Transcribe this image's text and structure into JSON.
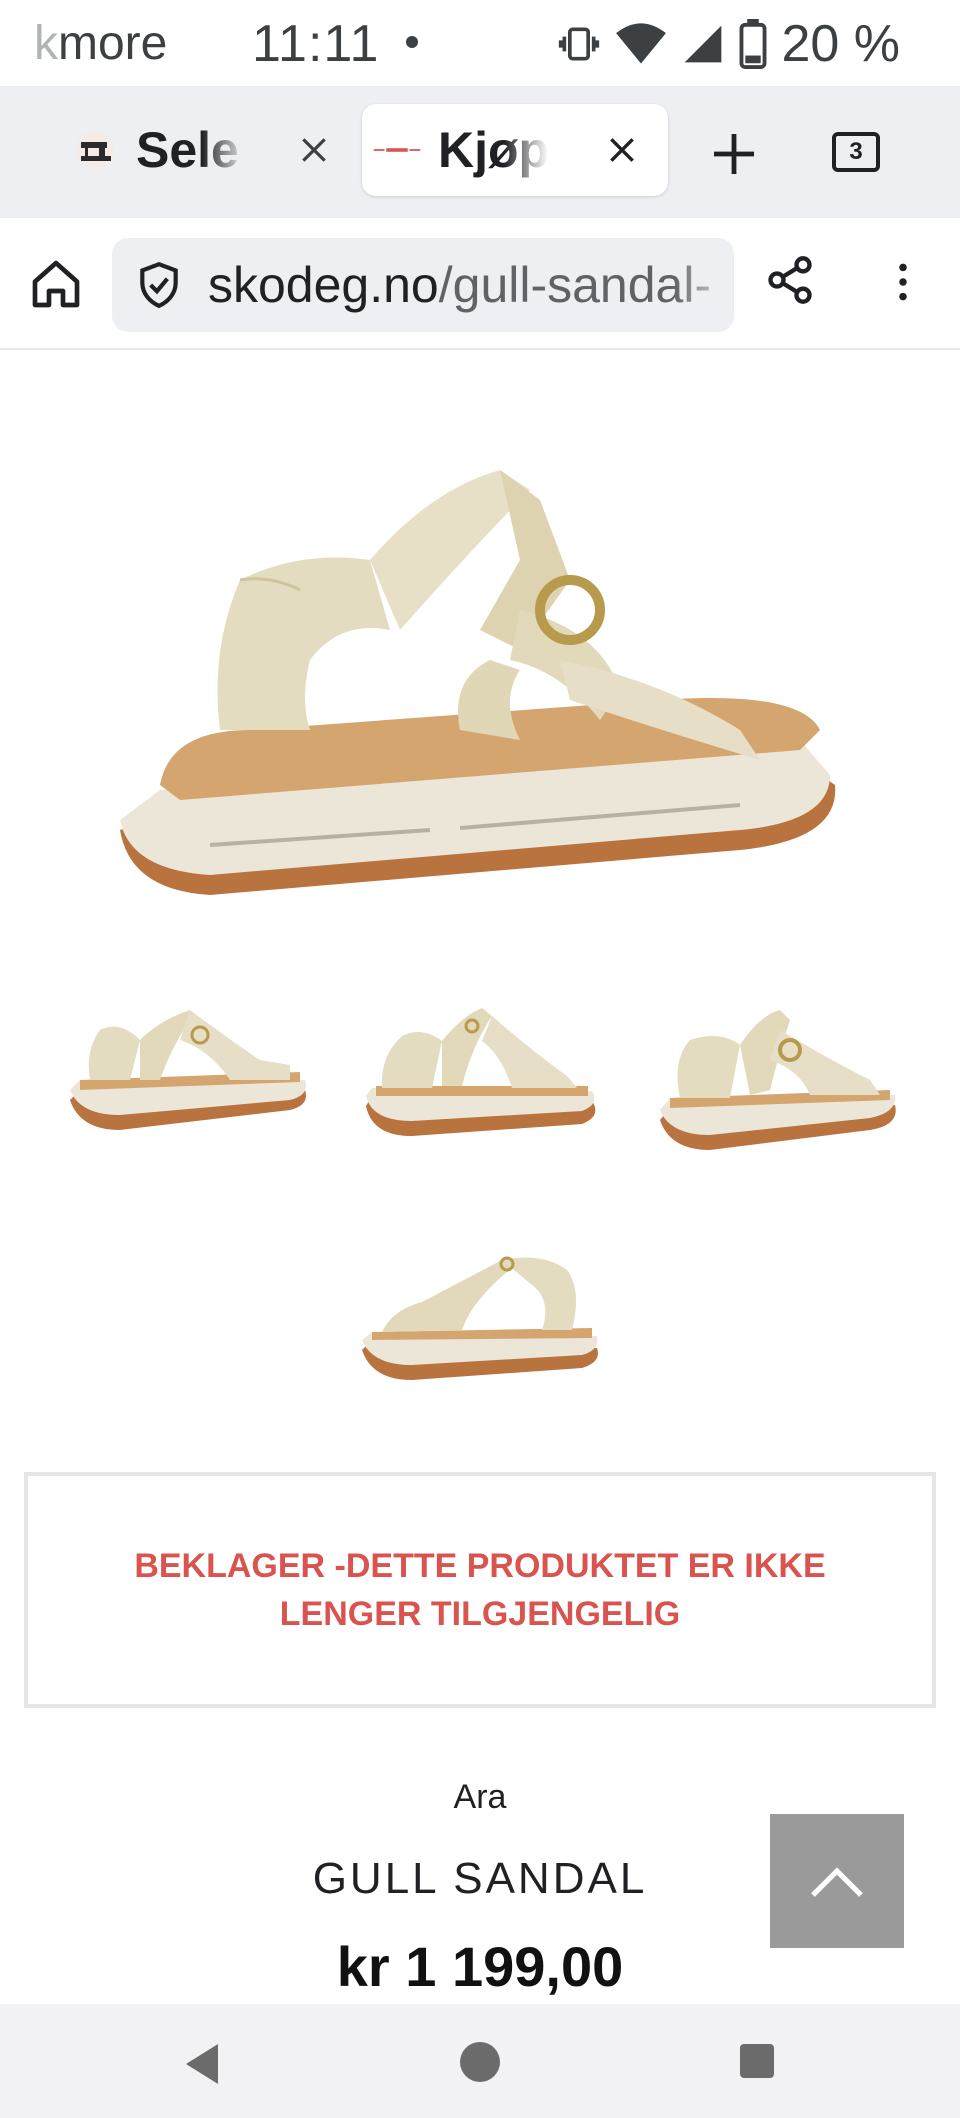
{
  "status_bar": {
    "app_fragment_faded": "k",
    "app_fragment": "more",
    "time": "11:11",
    "battery": "20 %"
  },
  "tabs": [
    {
      "title": "Sele",
      "favicon": "sewing-machine-icon",
      "active": false
    },
    {
      "title": "Kjøp",
      "favicon": "skodeg-logo",
      "active": true
    }
  ],
  "tab_count": "3",
  "address_bar": {
    "url_domain": "skodeg.no",
    "url_path": "/gull-sandal-"
  },
  "product": {
    "unavailable_notice": "BEKLAGER -DETTE PRODUKTET ER IKKE LENGER TILGJENGELIG",
    "brand": "Ara",
    "name": "GULL SANDAL",
    "price": "kr 1 199,00"
  },
  "colors": {
    "notice_red": "#d9534f",
    "tabstrip_bg": "#eeeff2",
    "back_to_top_bg": "#9a9a9a"
  }
}
